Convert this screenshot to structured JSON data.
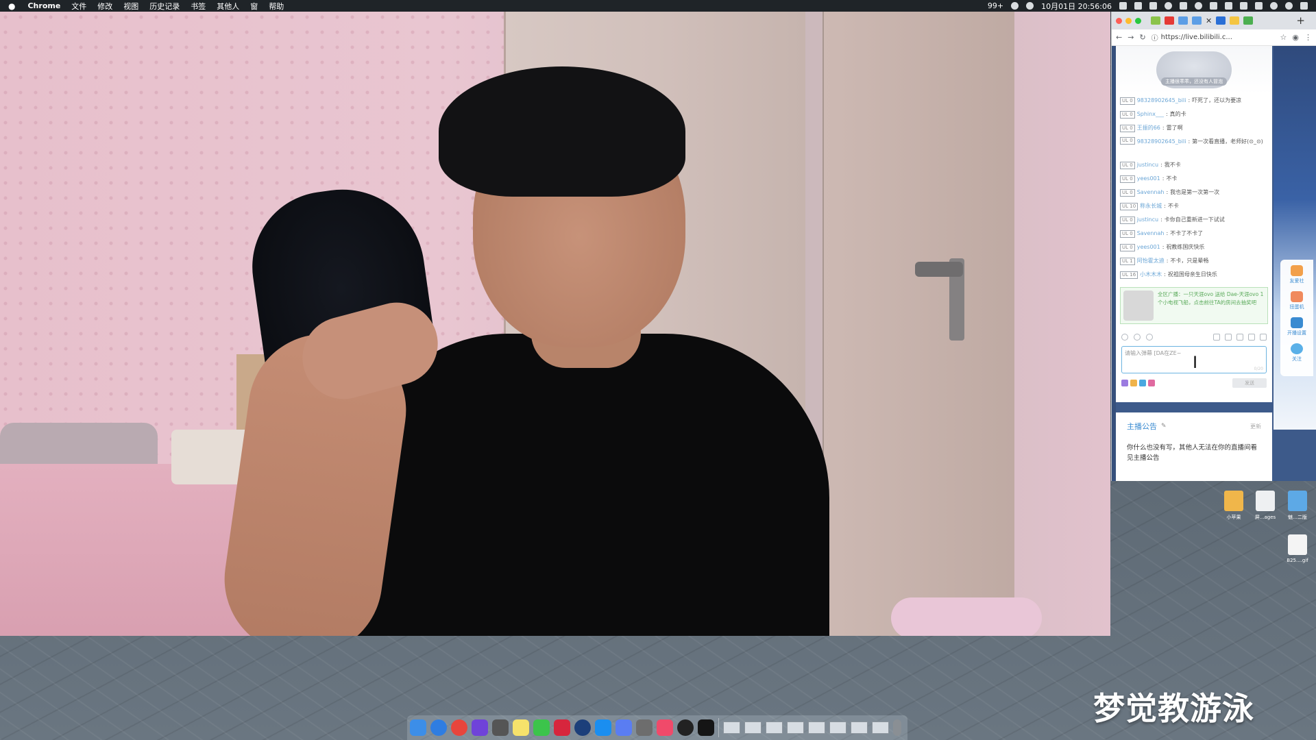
{
  "menubar": {
    "app_name": "Chrome",
    "menus": [
      "文件",
      "修改",
      "视图",
      "历史记录",
      "书签",
      "其他人",
      "窗",
      "帮助"
    ],
    "battery": "99+",
    "datetime": "10月01日 20:56:06"
  },
  "browser": {
    "url": "https://live.bilibili.c...",
    "chat_banner_text": "主播很乖乖，还没有人冒泡",
    "chat_messages": [
      {
        "level": "UL 0",
        "user": "98328902645_bili",
        "text": "吓死了，还以为要凉"
      },
      {
        "level": "UL 0",
        "user": "Sphinx___",
        "text": "真的卡"
      },
      {
        "level": "UL 0",
        "user": "王振的66",
        "text": "雷了啊"
      },
      {
        "level": "UL 0",
        "user": "98328902645_bili",
        "text": "第一次看直播，老师好(⊙_⊙)"
      },
      {
        "level": "UL 0",
        "user": "justincu",
        "text": "我不卡"
      },
      {
        "level": "UL 0",
        "user": "yees001",
        "text": "不卡"
      },
      {
        "level": "UL 0",
        "user": "Savennah",
        "text": "我也是第一次第一次"
      },
      {
        "level": "UL 10",
        "user": "称永长城",
        "text": "不卡"
      },
      {
        "level": "UL 0",
        "user": "justincu",
        "text": "卡你自己重新进一下试试"
      },
      {
        "level": "UL 0",
        "user": "Savennah",
        "text": "不卡了不卡了"
      },
      {
        "level": "UL 0",
        "user": "yees001",
        "text": "祝教练国庆快乐"
      },
      {
        "level": "UL 1",
        "user": "阿怡霍太迪",
        "text": "不卡，只是晕畅"
      },
      {
        "level": "UL 16",
        "user": "小木木木",
        "text": "祝祖国母亲生日快乐"
      }
    ],
    "gift_text": "全区广播：一只天涯ovo 送给 Dae-天涯ovo 1个小电视飞船，点击前往TA的房间去抽奖吧",
    "input_placeholder": "请输入弹幕 [DA在ZE~",
    "input_count": "0/20",
    "send_label": "发送",
    "side_tools": [
      "友爱社",
      "扭蛋机",
      "开播设置",
      "关注"
    ],
    "notice": {
      "title": "主播公告",
      "more": "更新",
      "body": "你什么也没有写，其他人无法在你的直播间看见主播公告"
    }
  },
  "desktop_icons": [
    {
      "label": "小苹果"
    },
    {
      "label": "屏...ages"
    },
    {
      "label": "魅...二版"
    },
    {
      "label": "B25....gif"
    }
  ],
  "watermark": "梦觉教游泳",
  "colors": {
    "menubar_bg": "#1f2428",
    "chat_user": "#6ba6d6",
    "accent_blue": "#3a8bd1",
    "gift_green": "#5aaa5a"
  }
}
